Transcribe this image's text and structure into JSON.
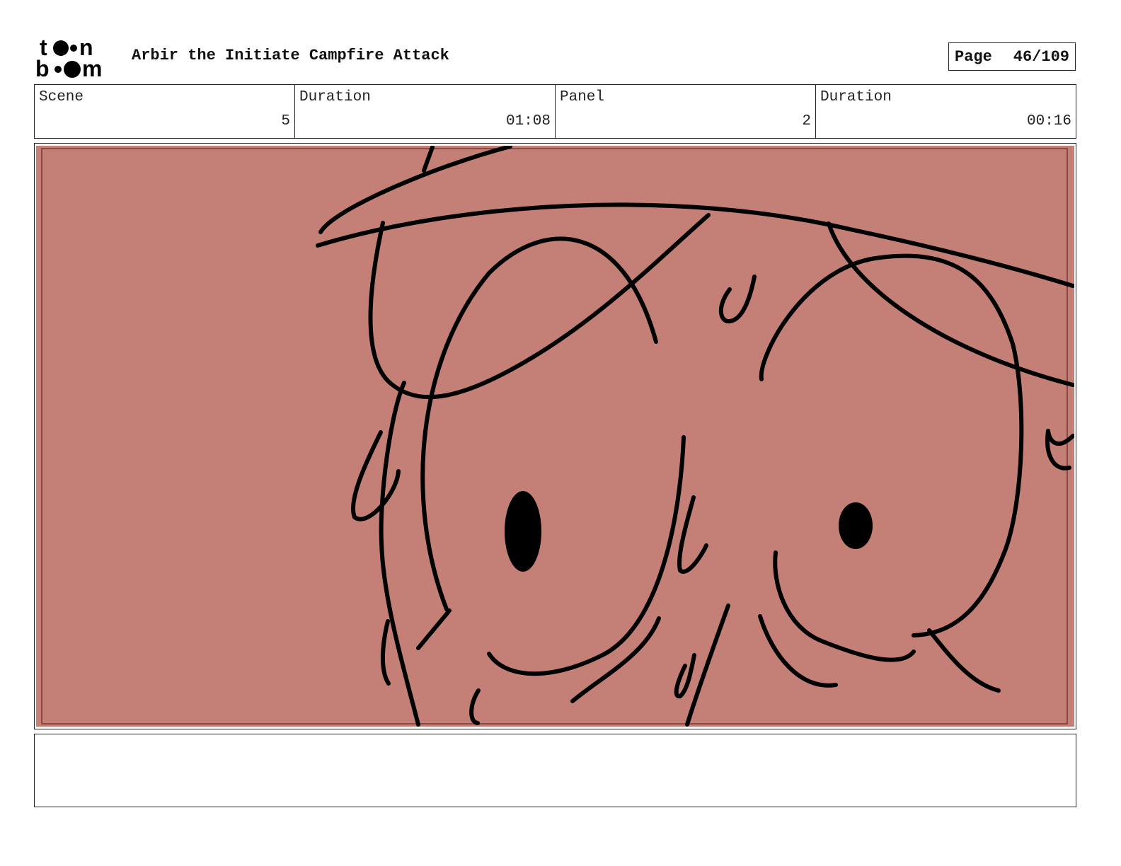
{
  "header": {
    "logo_text": "toon boom",
    "title": "Arbir the Initiate Campfire Attack",
    "page_label": "Page",
    "page_value": "46/109"
  },
  "info": {
    "scene_label": "Scene",
    "scene_value": "5",
    "scene_duration_label": "Duration",
    "scene_duration_value": "01:08",
    "panel_label": "Panel",
    "panel_value": "2",
    "panel_duration_label": "Duration",
    "panel_duration_value": "00:16"
  },
  "panel": {
    "background_color": "#c47f77",
    "inner_border_color": "#8a4a44",
    "stroke_color": "#000000"
  },
  "notes": {
    "text": ""
  }
}
